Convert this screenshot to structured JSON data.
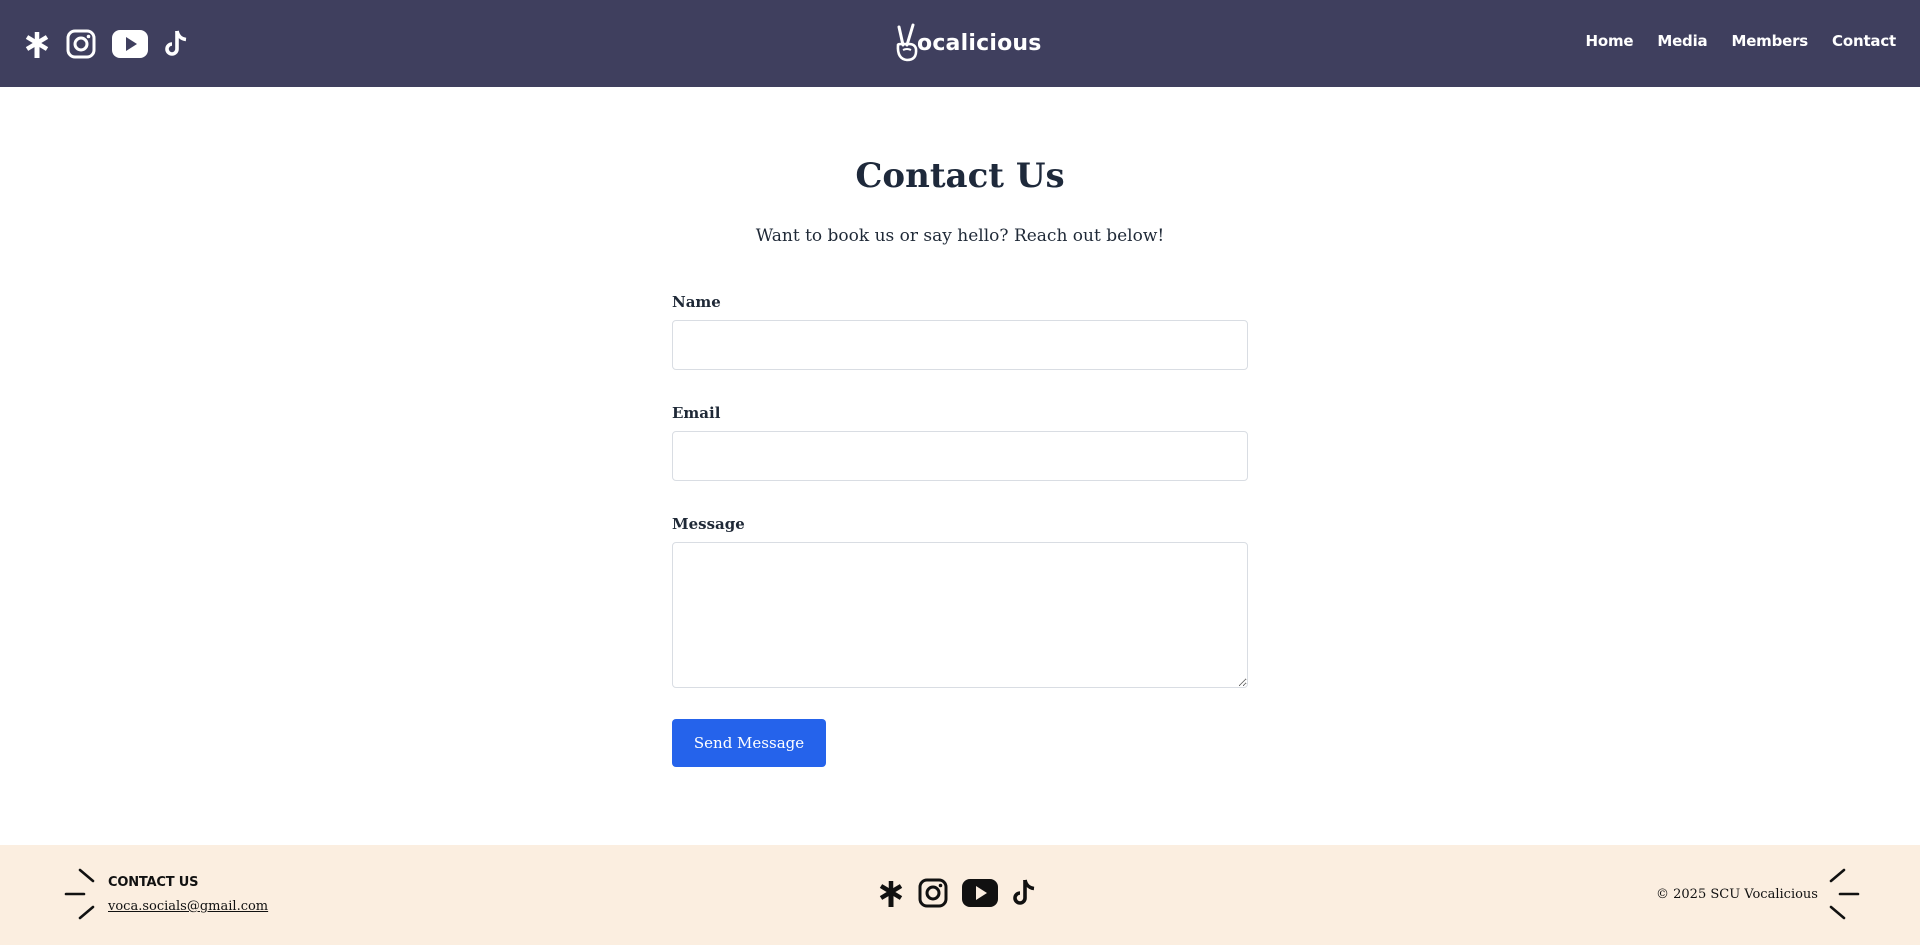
{
  "header": {
    "logo_text": "ocalicious",
    "social_icons": [
      "linktree-icon",
      "instagram-icon",
      "youtube-icon",
      "tiktok-icon"
    ],
    "nav": [
      "Home",
      "Media",
      "Members",
      "Contact"
    ]
  },
  "main": {
    "title": "Contact Us",
    "subtitle": "Want to book us or say hello? Reach out below!",
    "form": {
      "name_label": "Name",
      "name_value": "",
      "email_label": "Email",
      "email_value": "",
      "message_label": "Message",
      "message_value": "",
      "submit_label": "Send Message"
    }
  },
  "footer": {
    "contact_heading": "CONTACT US",
    "email": "voca.socials@gmail.com",
    "copyright": "© 2025 SCU Vocalicious",
    "social_icons": [
      "linktree-icon",
      "instagram-icon",
      "youtube-icon",
      "tiktok-icon"
    ]
  },
  "colors": {
    "header_bg": "#3f3f5e",
    "footer_bg": "#fbeee0",
    "accent_button": "#2563eb",
    "text_dark": "#1e293b"
  }
}
